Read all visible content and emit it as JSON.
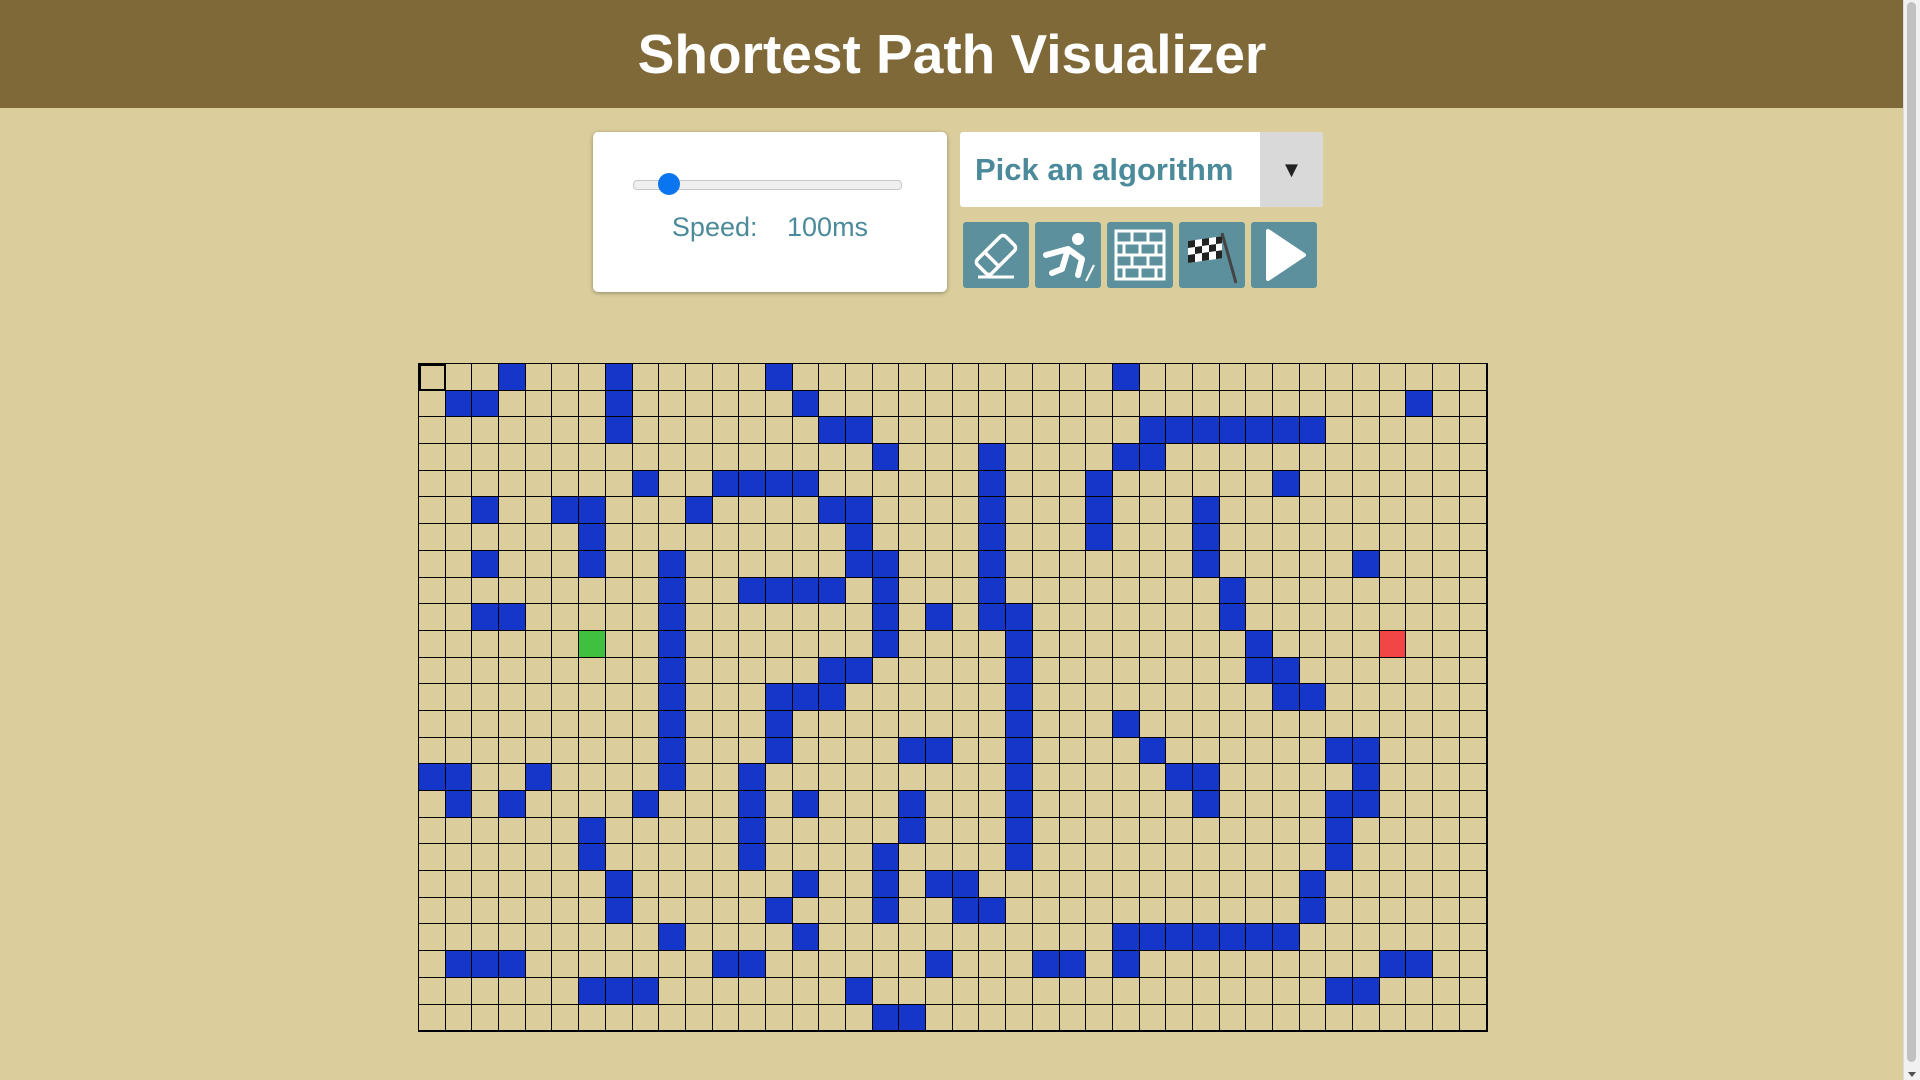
{
  "header": {
    "title": "Shortest Path Visualizer"
  },
  "speed": {
    "label": "Speed:",
    "value": "100ms",
    "slider_fraction": 0.1
  },
  "algorithm_select": {
    "label": "Pick an algorithm",
    "arrow": "▼"
  },
  "toolbar": [
    {
      "icon": "eraser-icon"
    },
    {
      "icon": "runner-start-icon"
    },
    {
      "icon": "brick-wall-icon"
    },
    {
      "icon": "checkered-flag-icon"
    },
    {
      "icon": "play-icon"
    }
  ],
  "colors": {
    "header": "#806939",
    "background": "#dbce9c",
    "wall": "#1536c9",
    "start": "#3fc03f",
    "end": "#f24545",
    "button": "#5c909d"
  },
  "grid": {
    "cols": 40,
    "rows": 25,
    "start": [
      10,
      6
    ],
    "end": [
      10,
      36
    ],
    "walls": [
      [
        0,
        3
      ],
      [
        0,
        7
      ],
      [
        0,
        13
      ],
      [
        0,
        26
      ],
      [
        1,
        1
      ],
      [
        1,
        2
      ],
      [
        1,
        7
      ],
      [
        1,
        14
      ],
      [
        1,
        37
      ],
      [
        2,
        7
      ],
      [
        2,
        15
      ],
      [
        2,
        16
      ],
      [
        2,
        27
      ],
      [
        2,
        28
      ],
      [
        2,
        29
      ],
      [
        2,
        30
      ],
      [
        2,
        31
      ],
      [
        2,
        32
      ],
      [
        2,
        33
      ],
      [
        3,
        17
      ],
      [
        3,
        21
      ],
      [
        3,
        26
      ],
      [
        3,
        27
      ],
      [
        4,
        8
      ],
      [
        4,
        11
      ],
      [
        4,
        12
      ],
      [
        4,
        13
      ],
      [
        4,
        14
      ],
      [
        4,
        21
      ],
      [
        4,
        25
      ],
      [
        4,
        32
      ],
      [
        5,
        2
      ],
      [
        5,
        5
      ],
      [
        5,
        6
      ],
      [
        5,
        10
      ],
      [
        5,
        15
      ],
      [
        5,
        16
      ],
      [
        5,
        21
      ],
      [
        5,
        25
      ],
      [
        5,
        29
      ],
      [
        6,
        6
      ],
      [
        6,
        16
      ],
      [
        6,
        21
      ],
      [
        6,
        25
      ],
      [
        6,
        29
      ],
      [
        7,
        2
      ],
      [
        7,
        6
      ],
      [
        7,
        9
      ],
      [
        7,
        16
      ],
      [
        7,
        17
      ],
      [
        7,
        21
      ],
      [
        7,
        29
      ],
      [
        7,
        35
      ],
      [
        8,
        9
      ],
      [
        8,
        12
      ],
      [
        8,
        13
      ],
      [
        8,
        14
      ],
      [
        8,
        15
      ],
      [
        8,
        17
      ],
      [
        8,
        21
      ],
      [
        8,
        30
      ],
      [
        9,
        2
      ],
      [
        9,
        3
      ],
      [
        9,
        9
      ],
      [
        9,
        17
      ],
      [
        9,
        19
      ],
      [
        9,
        21
      ],
      [
        9,
        22
      ],
      [
        9,
        30
      ],
      [
        10,
        9
      ],
      [
        10,
        17
      ],
      [
        10,
        22
      ],
      [
        10,
        31
      ],
      [
        11,
        9
      ],
      [
        11,
        15
      ],
      [
        11,
        16
      ],
      [
        11,
        22
      ],
      [
        11,
        31
      ],
      [
        11,
        32
      ],
      [
        12,
        9
      ],
      [
        12,
        13
      ],
      [
        12,
        14
      ],
      [
        12,
        15
      ],
      [
        12,
        22
      ],
      [
        12,
        32
      ],
      [
        12,
        33
      ],
      [
        13,
        9
      ],
      [
        13,
        13
      ],
      [
        13,
        22
      ],
      [
        13,
        26
      ],
      [
        14,
        9
      ],
      [
        14,
        13
      ],
      [
        14,
        18
      ],
      [
        14,
        19
      ],
      [
        14,
        22
      ],
      [
        14,
        27
      ],
      [
        14,
        34
      ],
      [
        14,
        35
      ],
      [
        15,
        0
      ],
      [
        15,
        1
      ],
      [
        15,
        4
      ],
      [
        15,
        9
      ],
      [
        15,
        12
      ],
      [
        15,
        22
      ],
      [
        15,
        28
      ],
      [
        15,
        29
      ],
      [
        15,
        35
      ],
      [
        16,
        1
      ],
      [
        16,
        3
      ],
      [
        16,
        8
      ],
      [
        16,
        12
      ],
      [
        16,
        14
      ],
      [
        16,
        18
      ],
      [
        16,
        22
      ],
      [
        16,
        29
      ],
      [
        16,
        34
      ],
      [
        16,
        35
      ],
      [
        17,
        6
      ],
      [
        17,
        12
      ],
      [
        17,
        18
      ],
      [
        17,
        22
      ],
      [
        17,
        34
      ],
      [
        18,
        6
      ],
      [
        18,
        12
      ],
      [
        18,
        17
      ],
      [
        18,
        22
      ],
      [
        18,
        34
      ],
      [
        19,
        7
      ],
      [
        19,
        14
      ],
      [
        19,
        17
      ],
      [
        19,
        19
      ],
      [
        19,
        20
      ],
      [
        19,
        33
      ],
      [
        20,
        7
      ],
      [
        20,
        13
      ],
      [
        20,
        17
      ],
      [
        20,
        20
      ],
      [
        20,
        21
      ],
      [
        20,
        33
      ],
      [
        21,
        9
      ],
      [
        21,
        14
      ],
      [
        21,
        26
      ],
      [
        21,
        27
      ],
      [
        21,
        28
      ],
      [
        21,
        29
      ],
      [
        21,
        30
      ],
      [
        21,
        31
      ],
      [
        21,
        32
      ],
      [
        22,
        1
      ],
      [
        22,
        2
      ],
      [
        22,
        3
      ],
      [
        22,
        11
      ],
      [
        22,
        12
      ],
      [
        22,
        19
      ],
      [
        22,
        23
      ],
      [
        22,
        24
      ],
      [
        22,
        26
      ],
      [
        22,
        36
      ],
      [
        22,
        37
      ],
      [
        23,
        6
      ],
      [
        23,
        7
      ],
      [
        23,
        8
      ],
      [
        23,
        16
      ],
      [
        23,
        34
      ],
      [
        23,
        35
      ],
      [
        24,
        17
      ],
      [
        24,
        18
      ]
    ]
  }
}
